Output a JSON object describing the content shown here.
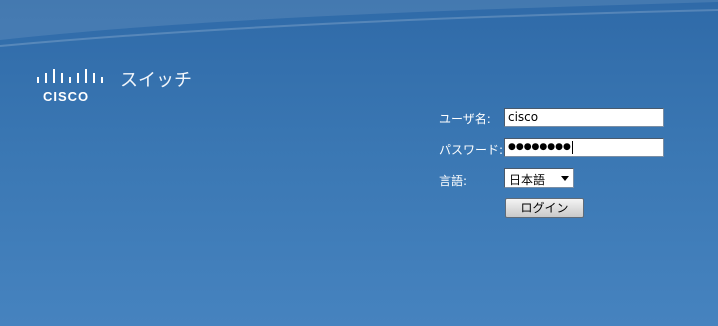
{
  "brand": {
    "logo_name": "cisco-logo",
    "logo_text": "CISCO",
    "app_title": "スイッチ"
  },
  "login_form": {
    "username_label": "ユーザ名:",
    "username_value": "cisco",
    "password_label": "パスワード:",
    "password_masked": "●●●●●●●●",
    "language_label": "言語:",
    "language_selected": "日本語",
    "login_button": "ログイン"
  },
  "colors": {
    "background_top": "#2f6aa8",
    "background_bottom": "#4683bf",
    "text": "#ffffff"
  }
}
